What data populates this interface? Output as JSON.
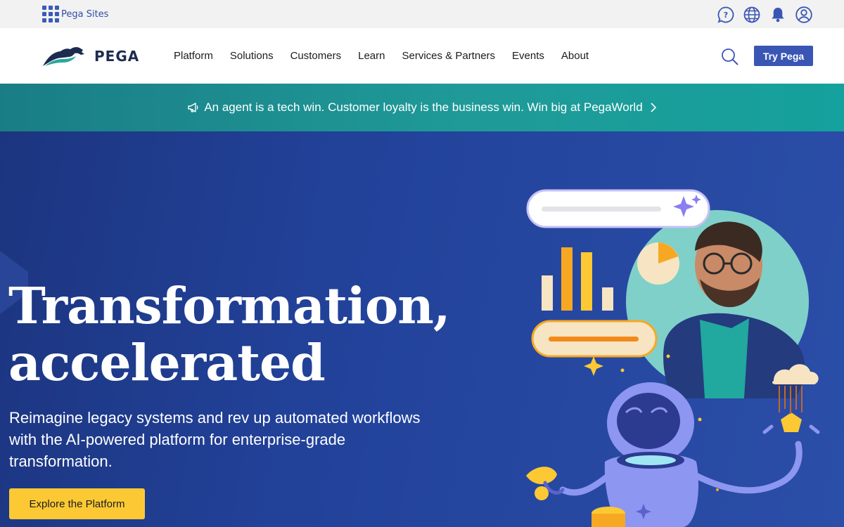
{
  "utility": {
    "sites_label": "Pega Sites",
    "icons": [
      "help-chat-icon",
      "globe-icon",
      "bell-icon",
      "user-account-icon"
    ]
  },
  "nav": {
    "logo_text": "PEGA",
    "items": [
      "Platform",
      "Solutions",
      "Customers",
      "Learn",
      "Services & Partners",
      "Events",
      "About"
    ],
    "search_icon": "search-icon",
    "cta_label": "Try Pega"
  },
  "announcement": {
    "text": "An agent is a tech win. Customer loyalty is the business win. Win big at PegaWorld"
  },
  "hero": {
    "title_line1": "Transformation,",
    "title_line2": "accelerated",
    "subtitle": "Reimagine legacy systems and rev up automated workflows with the AI-powered platform for enterprise-grade transformation.",
    "cta_label": "Explore the Platform"
  },
  "colors": {
    "brand_blue": "#3a56b5",
    "teal_banner": "#1f9a98",
    "hero_bg": "#22429a",
    "cta_yellow": "#fcc934"
  }
}
